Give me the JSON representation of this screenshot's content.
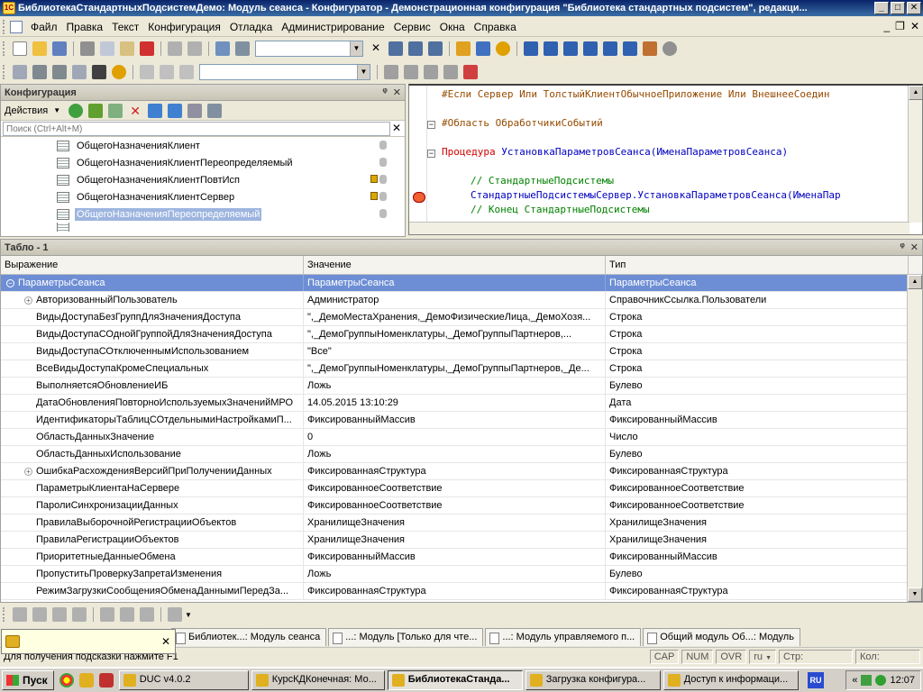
{
  "window": {
    "title": "БиблиотекаСтандартныхПодсистемДемо: Модуль сеанса - Конфигуратор - Демонстрационная конфигурация \"Библиотека стандартных подсистем\", редакци...",
    "minimize": "_",
    "maximize": "□",
    "close": "✕"
  },
  "menu": {
    "items": [
      "Файл",
      "Правка",
      "Текст",
      "Конфигурация",
      "Отладка",
      "Администрирование",
      "Сервис",
      "Окна",
      "Справка"
    ],
    "doc_minimize": "_",
    "doc_restore": "❐",
    "doc_close": "✕"
  },
  "config_panel": {
    "title": "Конфигурация",
    "pin": "ᵠ",
    "close": "✕",
    "actions_label": "Действия",
    "search_placeholder": "Поиск (Ctrl+Alt+M)",
    "search_clear": "✕",
    "items": [
      {
        "label": "ОбщегоНазначенияКлиент",
        "locked": false
      },
      {
        "label": "ОбщегоНазначенияКлиентПереопределяемый",
        "locked": false
      },
      {
        "label": "ОбщегоНазначенияКлиентПовтИсп",
        "locked": true
      },
      {
        "label": "ОбщегоНазначенияКлиентСервер",
        "locked": true
      },
      {
        "label": "ОбщегоНазначенияПереопределяемый",
        "locked": false,
        "selected": true
      }
    ]
  },
  "code": {
    "lines": [
      {
        "parts": [
          {
            "t": "#Если Сервер Или ТолстыйКлиентОбычноеПриложение Или ВнешнееСоедин",
            "c": "kw-brown"
          }
        ],
        "fold": false
      },
      {
        "parts": [
          {
            "t": "#Область ОбработчикиСобытий",
            "c": "kw-brown"
          }
        ],
        "fold": true
      },
      {
        "parts": [
          {
            "t": "Процедура ",
            "c": "kw-red"
          },
          {
            "t": "УстановкаПараметровСеанса(ИменаПараметровСеанса)",
            "c": "kw-blue"
          }
        ],
        "fold": true
      },
      {
        "parts": [
          {
            "t": "// СтандартныеПодсистемы",
            "c": "kw-green"
          }
        ],
        "fold": false
      },
      {
        "parts": [
          {
            "t": "СтандартныеПодсистемыСервер.УстановкаПараметровСеанса(ИменаПар",
            "c": "kw-blue"
          }
        ],
        "fold": false
      },
      {
        "parts": [
          {
            "t": "// Конец СтандартныеПодсистемы",
            "c": "kw-green"
          }
        ],
        "fold": false
      }
    ]
  },
  "table_panel": {
    "title": "Табло - 1",
    "pin": "ᵠ",
    "close": "✕",
    "columns": [
      "Выражение",
      "Значение",
      "Тип"
    ],
    "root": {
      "expr": "ПараметрыСеанса",
      "value": "ПараметрыСеанса",
      "type": "ПараметрыСеанса"
    },
    "rows": [
      {
        "expr": "АвторизованныйПользователь",
        "value": "Администратор",
        "type": "СправочникСсылка.Пользователи",
        "expandable": true
      },
      {
        "expr": "ВидыДоступаБезГруппДляЗначенияДоступа",
        "value": "\",_ДемоМестаХранения,_ДемоФизическиеЛица,_ДемоХозя...",
        "type": "Строка",
        "expandable": false
      },
      {
        "expr": "ВидыДоступаСОднойГруппойДляЗначенияДоступа",
        "value": "\",_ДемоГруппыНоменклатуры,_ДемоГруппыПартнеров,...",
        "type": "Строка",
        "expandable": false
      },
      {
        "expr": "ВидыДоступаСОтключеннымИспользованием",
        "value": "\"Все\"",
        "type": "Строка",
        "expandable": false
      },
      {
        "expr": "ВсеВидыДоступаКромеСпециальных",
        "value": "\",_ДемоГруппыНоменклатуры,_ДемоГруппыПартнеров,_Де...",
        "type": "Строка",
        "expandable": false
      },
      {
        "expr": "ВыполняетсяОбновлениеИБ",
        "value": "Ложь",
        "type": "Булево",
        "expandable": false
      },
      {
        "expr": "ДатаОбновленияПовторноИспользуемыхЗначенийМРО",
        "value": "14.05.2015 13:10:29",
        "type": "Дата",
        "expandable": false
      },
      {
        "expr": "ИдентификаторыТаблицСОтдельнымиНастройкамиП...",
        "value": "ФиксированныйМассив",
        "type": "ФиксированныйМассив",
        "expandable": false
      },
      {
        "expr": "ОбластьДанныхЗначение",
        "value": "0",
        "type": "Число",
        "expandable": false
      },
      {
        "expr": "ОбластьДанныхИспользование",
        "value": "Ложь",
        "type": "Булево",
        "expandable": false
      },
      {
        "expr": "ОшибкаРасхожденияВерсийПриПолученииДанных",
        "value": "ФиксированнаяСтруктура",
        "type": "ФиксированнаяСтруктура",
        "expandable": true
      },
      {
        "expr": "ПараметрыКлиентаНаСервере",
        "value": "ФиксированноеСоответствие",
        "type": "ФиксированноеСоответствие",
        "expandable": false
      },
      {
        "expr": "ПаролиСинхронизацииДанных",
        "value": "ФиксированноеСоответствие",
        "type": "ФиксированноеСоответствие",
        "expandable": false
      },
      {
        "expr": "ПравилаВыборочнойРегистрацииОбъектов",
        "value": "ХранилищеЗначения",
        "type": "ХранилищеЗначения",
        "expandable": false
      },
      {
        "expr": "ПравилаРегистрацииОбъектов",
        "value": "ХранилищеЗначения",
        "type": "ХранилищеЗначения",
        "expandable": false
      },
      {
        "expr": "ПриоритетныеДанныеОбмена",
        "value": "ФиксированныйМассив",
        "type": "ФиксированныйМассив",
        "expandable": false
      },
      {
        "expr": "ПропуститьПроверкуЗапретаИзменения",
        "value": "Ложь",
        "type": "Булево",
        "expandable": false
      },
      {
        "expr": "РежимЗагрузкиСообщенияОбменаДаннымиПередЗа...",
        "value": "ФиксированнаяСтруктура",
        "type": "ФиксированнаяСтруктура",
        "expandable": false
      }
    ]
  },
  "window_tabs": [
    "Библиотек...: Модуль сеанса",
    "...: Модуль [Только для чте...",
    "...: Модуль управляемого п...",
    "Общий модуль Об...: Модуль"
  ],
  "popup": {
    "close": "✕"
  },
  "status": {
    "hint": "Для получения подсказки нажмите F1",
    "caps": "CAP",
    "num": "NUM",
    "ovr": "OVR",
    "lang": "ru",
    "row_label": "Стр:",
    "col_label": "Кол:"
  },
  "taskbar": {
    "start": "Пуск",
    "tasks": [
      {
        "label": "DUC v4.0.2",
        "active": false
      },
      {
        "label": "КурсКДКонечная: Мо...",
        "active": false
      },
      {
        "label": "БиблиотекаСтанда...",
        "active": true
      },
      {
        "label": "Загрузка конфигура...",
        "active": false
      },
      {
        "label": "Доступ к информаци...",
        "active": false
      }
    ],
    "lang": "RU",
    "tray_chevron": "«",
    "clock": "12:07"
  }
}
